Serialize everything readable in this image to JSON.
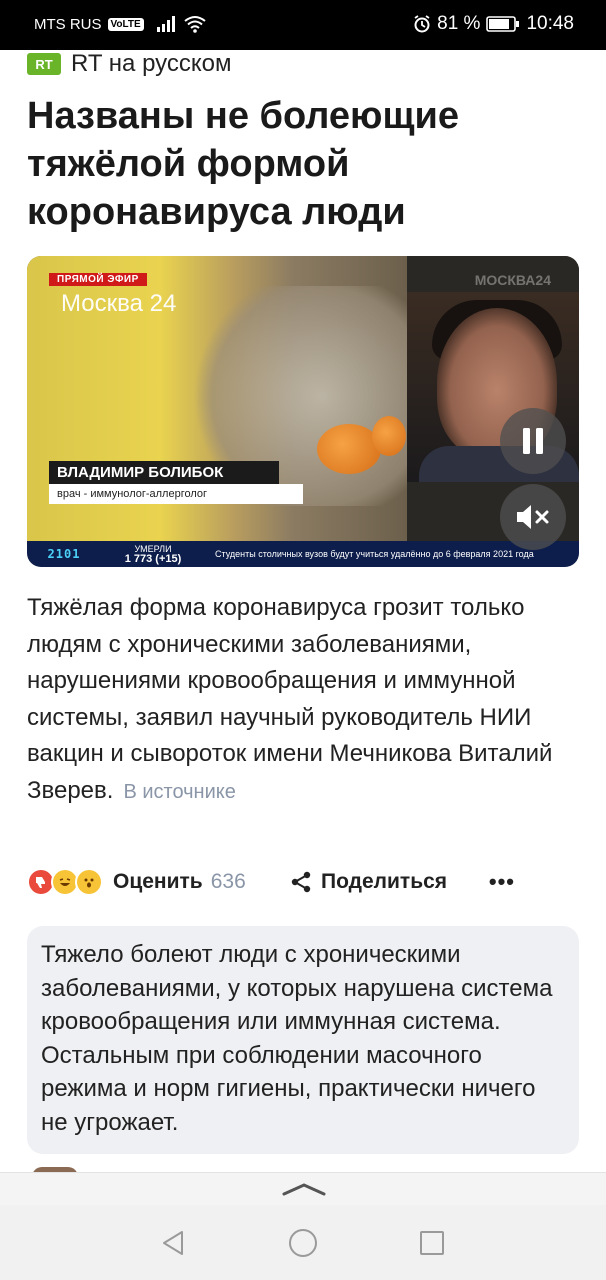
{
  "status_bar": {
    "carrier": "MTS RUS",
    "volte": "VoLTE",
    "battery": "81 %",
    "time": "10:48"
  },
  "source": {
    "logo_text": "RT",
    "name": "RT на русском",
    "logo_color": "#6ab42a"
  },
  "headline": "Названы не болеющие тяжёлой формой коронавируса люди",
  "video": {
    "live_badge": "ПРЯМОЙ ЭФИР",
    "channel": "Москва 24",
    "watermark": "МОСКВА24",
    "speaker_name": "ВЛАДИМИР БОЛИБОК",
    "speaker_role": "врач - иммунолог-аллерголог",
    "ticker_number": "2101",
    "deaths_label": "УМЕРЛИ",
    "deaths_value": "1 773 (+15)",
    "news_line": "Студенты столичных вузов будут учиться удалённо до 6 февраля 2021 года",
    "pause_icon": "pause-icon",
    "mute_icon": "mute-icon"
  },
  "lead": {
    "text": "Тяжёлая форма коронавируса грозит только людям с хроническими заболеваниями, нарушениями кровообращения и иммунной системы, заявил научный руководитель НИИ вакцин и сывороток имени Мечникова Виталий Зверев.",
    "source_link": "В источнике"
  },
  "actions": {
    "rate_label": "Оценить",
    "rate_count": "636",
    "share_label": "Поделиться",
    "more_label": "•••"
  },
  "quote": "Тяжело болеют люди с хроническими заболеваниями, у которых нарушена система кровообращения или иммунная система. Остальным при соблюдении масочного режима и норм гигиены, практически ничего не угрожает."
}
